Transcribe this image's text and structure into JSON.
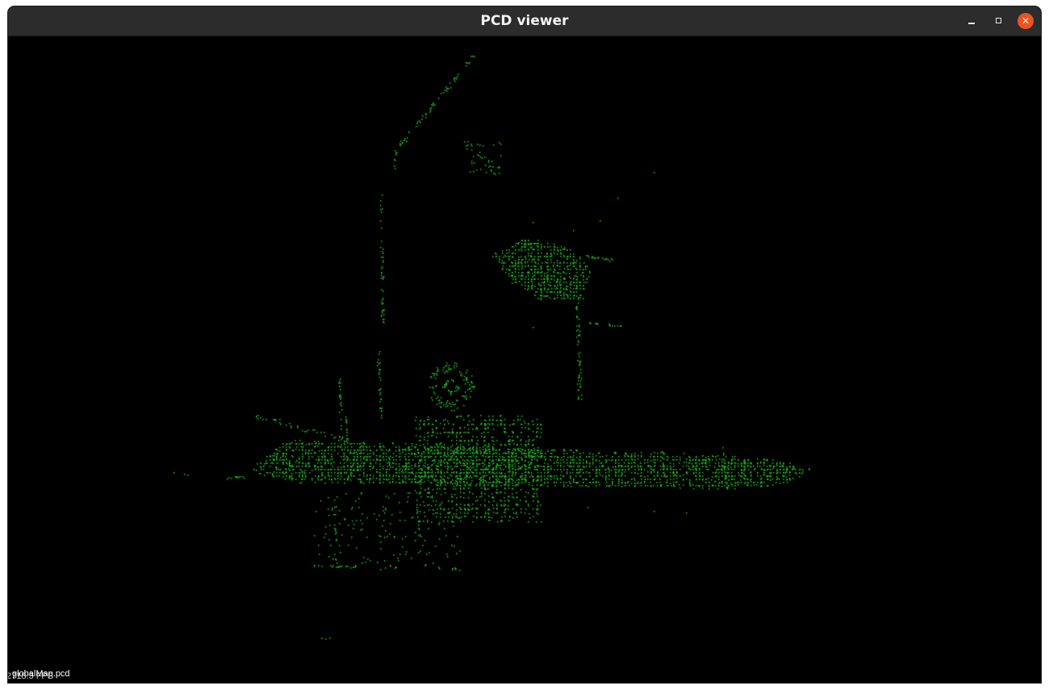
{
  "window": {
    "title": "PCD viewer",
    "controls": {
      "minimize": "minimize-icon",
      "maximize": "maximize-icon",
      "close": "close-icon"
    }
  },
  "viewer": {
    "background_color": "#000000",
    "point_color": "#1fb41f",
    "file_label": "globalMap.pcd",
    "fps_label": "2718.3 FPS"
  }
}
